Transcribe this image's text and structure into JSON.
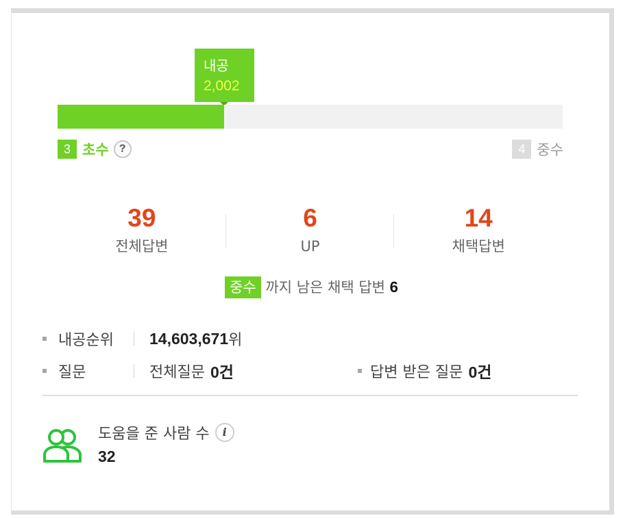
{
  "progress": {
    "tooltip_label": "내공",
    "tooltip_value": "2,002",
    "fill_fraction": 0.33,
    "current_level_num": "3",
    "current_level_name": "초수",
    "next_level_num": "4",
    "next_level_name": "중수",
    "help_icon_text": "?"
  },
  "stats": [
    {
      "value": "39",
      "label": "전체답변"
    },
    {
      "value": "6",
      "label": "UP"
    },
    {
      "value": "14",
      "label": "채택답변"
    }
  ],
  "remain": {
    "tag": "중수",
    "text": "까지 남은 채택 답변",
    "count": "6"
  },
  "info": {
    "rank_label": "내공순위",
    "rank_value": "14,603,671",
    "rank_unit": "위",
    "question_label": "질문",
    "total_q_label": "전체질문",
    "total_q_value": "0건",
    "answered_q_label": "답변 받은 질문",
    "answered_q_value": "0건"
  },
  "helped": {
    "title": "도움을 준 사람 수",
    "info_icon_text": "i",
    "count": "32"
  },
  "colors": {
    "accent_green": "#6fd126",
    "stat_orange": "#e0471b",
    "tooltip_value_yellow": "#f0ff40"
  }
}
